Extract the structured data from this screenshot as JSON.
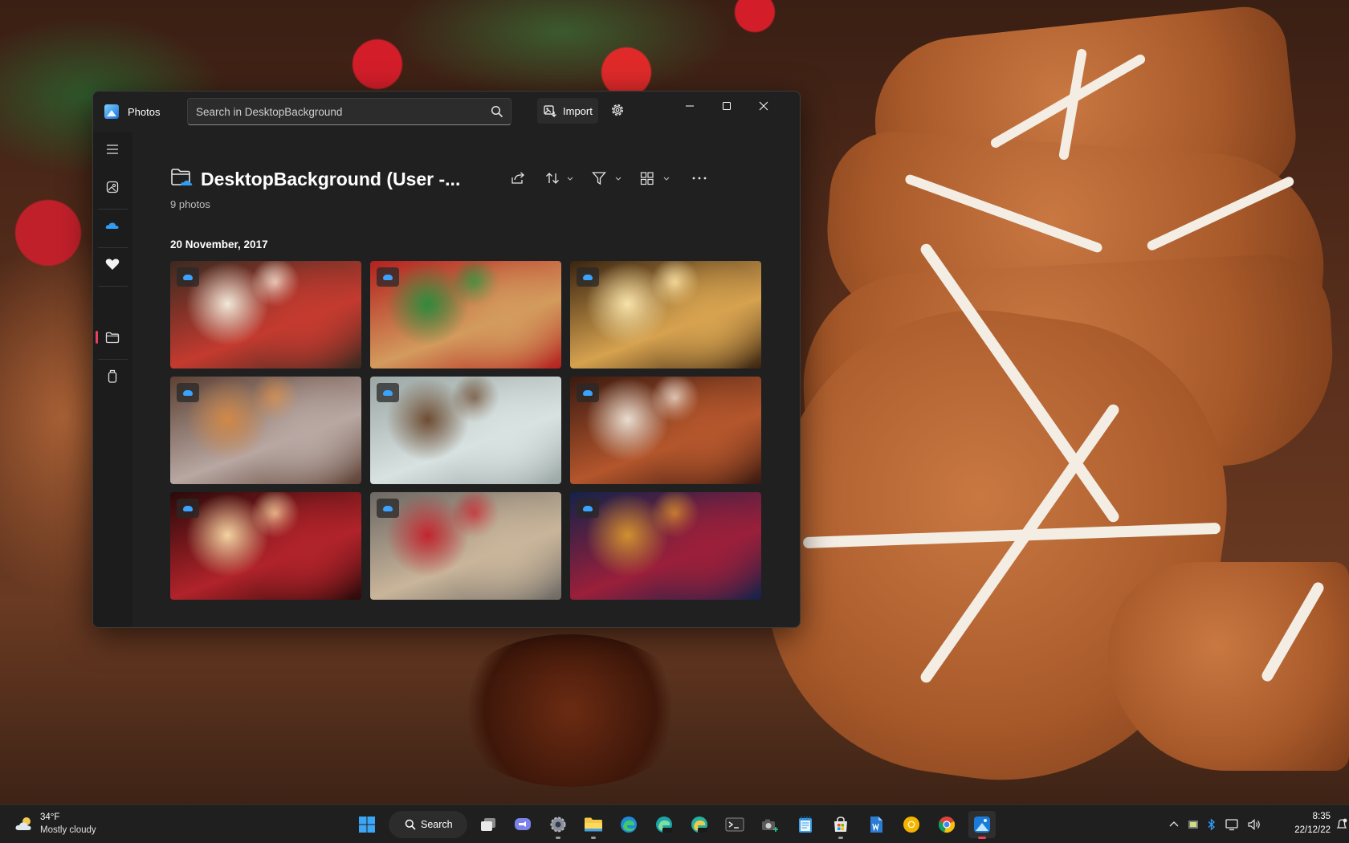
{
  "window": {
    "app_name": "Photos",
    "search_placeholder": "Search in DesktopBackground",
    "import_label": "Import",
    "folder_title": "DesktopBackground (User -...",
    "photo_count": "9 photos",
    "date_heading": "20 November, 2017"
  },
  "sidebar": {
    "items": [
      "menu-icon",
      "gallery-icon",
      "onedrive-icon",
      "favorites-icon",
      "folders-icon",
      "ipod-device-icon"
    ],
    "selected": "folders"
  },
  "toolbar": [
    "share-icon",
    "sort-icon",
    "filter-icon",
    "view-icon",
    "more-icon"
  ],
  "photos": [
    {
      "subject": "snowmen",
      "colors": [
        "#3a2a20",
        "#c43a2f",
        "#f1e8d8"
      ]
    },
    {
      "subject": "gingerbread cookies in red box",
      "colors": [
        "#b3201f",
        "#d39b5d",
        "#2f8a3c"
      ]
    },
    {
      "subject": "lanterns bokeh",
      "colors": [
        "#3a2410",
        "#d6a24f",
        "#f7e2a8"
      ]
    },
    {
      "subject": "gingerbread men on plate",
      "colors": [
        "#5c4033",
        "#b8a7a2",
        "#d08848"
      ]
    },
    {
      "subject": "pine cone in snow",
      "colors": [
        "#9aa6a3",
        "#d8e2e1",
        "#6e4d33"
      ]
    },
    {
      "subject": "cinnamon and star cookies",
      "colors": [
        "#3b1a10",
        "#b4562c",
        "#e8dccf"
      ]
    },
    {
      "subject": "red bell ornament",
      "colors": [
        "#2a0a0a",
        "#b1232a",
        "#f2d2a0"
      ]
    },
    {
      "subject": "jar of cookies with ribbon",
      "colors": [
        "#6c6864",
        "#c9b59a",
        "#c2262f"
      ]
    },
    {
      "subject": "snowflake ornament bokeh",
      "colors": [
        "#14224a",
        "#9b1f3a",
        "#d09030"
      ]
    }
  ],
  "taskbar": {
    "weather_temp": "34°F",
    "weather_desc": "Mostly cloudy",
    "search_label": "Search",
    "apps": [
      "windows-start-icon",
      "task-view-icon",
      "teams-chat-icon",
      "settings-icon",
      "file-explorer-icon",
      "edge-icon",
      "edge-beta-icon",
      "edge-canary-icon",
      "terminal-icon",
      "snipping-tool-icon",
      "notepad-icon",
      "microsoft-store-icon",
      "word-icon",
      "chrome-canary-icon",
      "chrome-icon",
      "photos-icon"
    ],
    "time": "8:35",
    "date": "22/12/22"
  }
}
